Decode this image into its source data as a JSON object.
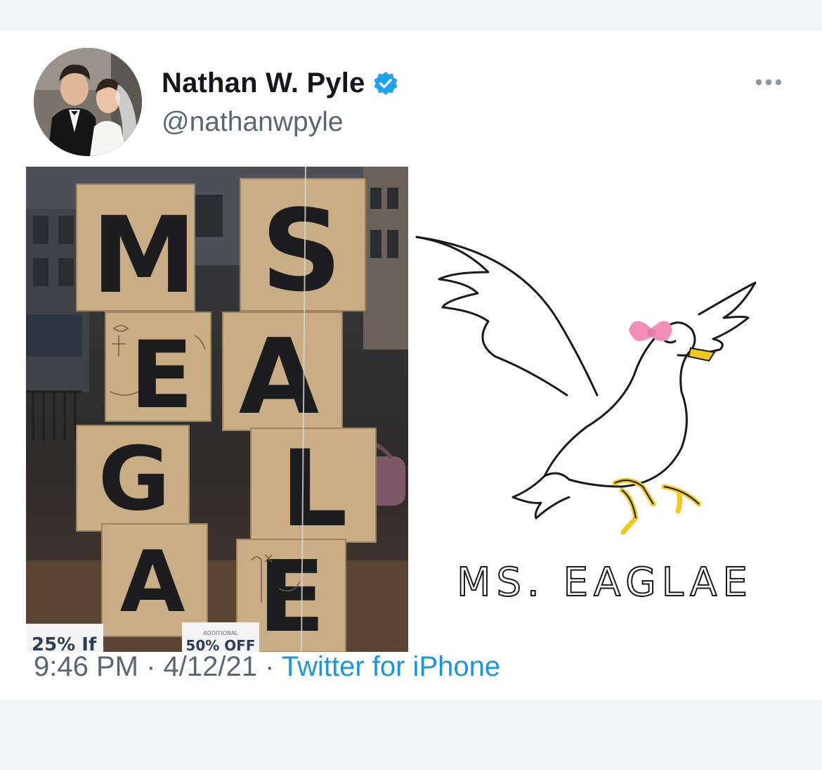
{
  "tweet": {
    "display_name": "Nathan W. Pyle",
    "handle": "@nathanwpyle",
    "time": "9:46 PM",
    "separator": "·",
    "date": "4/12/21",
    "source": "Twitter for iPhone"
  },
  "photo": {
    "box_letters": [
      "M",
      "S",
      "E",
      "A",
      "G",
      "L",
      "A",
      "E"
    ],
    "sign_left": "25% If",
    "sign_right_small": "ADDITIONAL",
    "sign_right": "50% OFF"
  },
  "drawing": {
    "caption": "MS. EAGLAE"
  },
  "icons": {
    "verified": "verified-badge-icon",
    "more": "more-options-icon",
    "accent": "#1da1f2",
    "bow_color": "#f28fb9",
    "beak_color": "#f2c81f"
  }
}
